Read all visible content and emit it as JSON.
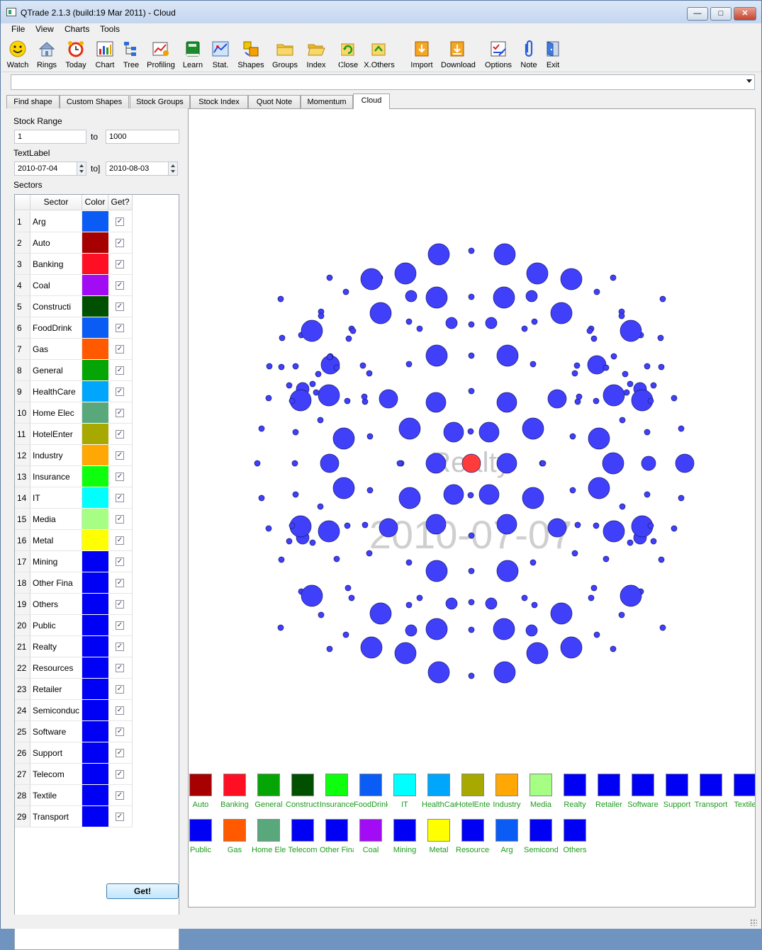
{
  "window": {
    "title": "QTrade 2.1.3 (build:19 Mar 2011) - Cloud"
  },
  "menu": [
    "File",
    "View",
    "Charts",
    "Tools"
  ],
  "toolbar": [
    {
      "label": "Watch",
      "icon": "smiley-icon"
    },
    {
      "label": "Rings",
      "icon": "house-icon"
    },
    {
      "label": "Today",
      "icon": "alarm-clock-icon"
    },
    {
      "label": "Chart",
      "icon": "bar-chart-icon"
    },
    {
      "label": "Tree",
      "icon": "tree-icon"
    },
    {
      "label": "Profiling",
      "icon": "profile-chart-icon"
    },
    {
      "label": "Learn",
      "icon": "book-icon"
    },
    {
      "label": "Stat.",
      "icon": "stats-icon"
    },
    {
      "label": "Shapes",
      "icon": "shapes-icon"
    },
    {
      "label": "Groups",
      "icon": "folder-icon"
    },
    {
      "label": "Index",
      "icon": "folder-open-icon"
    },
    {
      "label": "Close",
      "icon": "close-folder-icon"
    },
    {
      "label": "X.Others",
      "icon": "x-others-icon"
    },
    {
      "label": "Import",
      "icon": "import-icon"
    },
    {
      "label": "Download",
      "icon": "download-icon"
    },
    {
      "label": "Options",
      "icon": "options-icon"
    },
    {
      "label": "Note",
      "icon": "paperclip-icon"
    },
    {
      "label": "Exit",
      "icon": "exit-door-icon"
    }
  ],
  "combo": {
    "value": ""
  },
  "tabs": [
    {
      "label": "Find shape"
    },
    {
      "label": "Custom Shapes"
    },
    {
      "label": "Stock Groups"
    },
    {
      "label": "Stock Index"
    },
    {
      "label": "Quot Note"
    },
    {
      "label": "Momentum"
    },
    {
      "label": "Cloud",
      "active": true
    }
  ],
  "left": {
    "stock_range_label": "Stock Range",
    "range_from": "1",
    "range_to_label": "to",
    "range_to": "1000",
    "text_label": "TextLabel",
    "date_from": "2010-07-04",
    "date_to_label": "to]",
    "date_to": "2010-08-03",
    "sectors_label": "Sectors",
    "headers": {
      "sector": "Sector",
      "color": "Color",
      "get": "Get?"
    },
    "get_button": "Get!"
  },
  "sectors": [
    {
      "num": "1",
      "name": "Arg",
      "color": "#0a5cf5",
      "checked": true
    },
    {
      "num": "2",
      "name": "Auto",
      "color": "#a60000",
      "checked": true
    },
    {
      "num": "3",
      "name": "Banking",
      "color": "#ff0f24",
      "checked": true
    },
    {
      "num": "4",
      "name": "Coal",
      "color": "#a20cf4",
      "checked": true
    },
    {
      "num": "5",
      "name": "Constructi",
      "color": "#005000",
      "checked": true
    },
    {
      "num": "6",
      "name": "FoodDrink",
      "color": "#0a5cf5",
      "checked": true
    },
    {
      "num": "7",
      "name": "Gas",
      "color": "#ff5a00",
      "checked": true
    },
    {
      "num": "8",
      "name": "General",
      "color": "#04a504",
      "checked": true
    },
    {
      "num": "9",
      "name": "HealthCare",
      "color": "#00a6fb",
      "checked": true
    },
    {
      "num": "10",
      "name": "Home Elec",
      "color": "#58a87c",
      "checked": true
    },
    {
      "num": "11",
      "name": "HotelEnter",
      "color": "#a7a900",
      "checked": true
    },
    {
      "num": "12",
      "name": "Industry",
      "color": "#ffa805",
      "checked": true
    },
    {
      "num": "13",
      "name": "Insurance",
      "color": "#0dff0d",
      "checked": true
    },
    {
      "num": "14",
      "name": "IT",
      "color": "#00ffff",
      "checked": true
    },
    {
      "num": "15",
      "name": "Media",
      "color": "#a6fe84",
      "checked": true
    },
    {
      "num": "16",
      "name": "Metal",
      "color": "#ffff00",
      "checked": true
    },
    {
      "num": "17",
      "name": "Mining",
      "color": "#0000f5",
      "checked": true
    },
    {
      "num": "18",
      "name": "Other Fina",
      "color": "#0000f5",
      "checked": true
    },
    {
      "num": "19",
      "name": "Others",
      "color": "#0000f5",
      "checked": true
    },
    {
      "num": "20",
      "name": "Public",
      "color": "#0000f5",
      "checked": true
    },
    {
      "num": "21",
      "name": "Realty",
      "color": "#0000f5",
      "checked": true
    },
    {
      "num": "22",
      "name": "Resources",
      "color": "#0000f5",
      "checked": true
    },
    {
      "num": "23",
      "name": "Retailer",
      "color": "#0000f5",
      "checked": true
    },
    {
      "num": "24",
      "name": "Semiconduc",
      "color": "#0000f5",
      "checked": true
    },
    {
      "num": "25",
      "name": "Software",
      "color": "#0000f5",
      "checked": true
    },
    {
      "num": "26",
      "name": "Support",
      "color": "#0000f5",
      "checked": true
    },
    {
      "num": "27",
      "name": "Telecom",
      "color": "#0000f5",
      "checked": true
    },
    {
      "num": "28",
      "name": "Textile",
      "color": "#0000f5",
      "checked": true
    },
    {
      "num": "29",
      "name": "Transport",
      "color": "#0000f5",
      "checked": true
    }
  ],
  "cloud": {
    "center_sector": "Realty",
    "date_label": "2010-07-07",
    "bubble_color": "#4040fa",
    "highlight_color": "#ff3b3b"
  },
  "legend_row1": [
    {
      "label": "Auto",
      "color": "#a60000"
    },
    {
      "label": "Banking",
      "color": "#ff0f24"
    },
    {
      "label": "General",
      "color": "#04a504"
    },
    {
      "label": "Constructi",
      "color": "#005000"
    },
    {
      "label": "Insurance",
      "color": "#0dff0d"
    },
    {
      "label": "FoodDrink",
      "color": "#0a5cf5"
    },
    {
      "label": "IT",
      "color": "#00ffff"
    },
    {
      "label": "HealthCare",
      "color": "#00a6fb"
    },
    {
      "label": "HotelEnter",
      "color": "#a7a900"
    },
    {
      "label": "Industry",
      "color": "#ffa805"
    },
    {
      "label": "Media",
      "color": "#a6fe84"
    },
    {
      "label": "Realty",
      "color": "#0000f5"
    },
    {
      "label": "Retailer",
      "color": "#0000f5"
    },
    {
      "label": "Software",
      "color": "#0000f5"
    },
    {
      "label": "Support",
      "color": "#0000f5"
    },
    {
      "label": "Transport",
      "color": "#0000f5"
    },
    {
      "label": "Textile",
      "color": "#0000f5"
    }
  ],
  "legend_row2": [
    {
      "label": "Public",
      "color": "#0000f5"
    },
    {
      "label": "Gas",
      "color": "#ff5a00"
    },
    {
      "label": "Home Elec",
      "color": "#58a87c"
    },
    {
      "label": "Telecom",
      "color": "#0000f5"
    },
    {
      "label": "Other Fina",
      "color": "#0000f5"
    },
    {
      "label": "Coal",
      "color": "#a20cf4"
    },
    {
      "label": "Mining",
      "color": "#0000f5"
    },
    {
      "label": "Metal",
      "color": "#ffff00"
    },
    {
      "label": "Resources",
      "color": "#0000f5"
    },
    {
      "label": "Arg",
      "color": "#0a5cf5"
    },
    {
      "label": "Semiconduc",
      "color": "#0000f5"
    },
    {
      "label": "Others",
      "color": "#0000f5"
    }
  ]
}
